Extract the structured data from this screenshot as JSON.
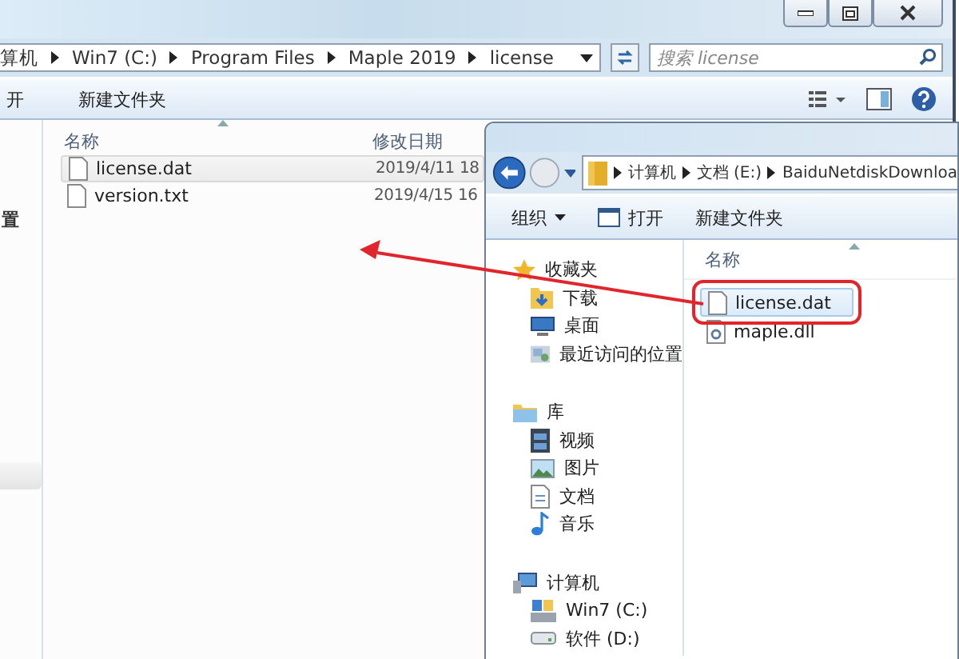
{
  "back_window": {
    "breadcrumb": [
      "算机",
      "Win7 (C:)",
      "Program Files",
      "Maple 2019",
      "license"
    ],
    "search": {
      "placeholder": "搜索 license"
    },
    "toolbar": [
      "开",
      "新建文件夹"
    ],
    "sidebar_fragment": "置",
    "columns": [
      "名称",
      "修改日期"
    ],
    "files": [
      {
        "name": "license.dat",
        "modified": "2019/4/11 18",
        "selected": true
      },
      {
        "name": "version.txt",
        "modified": "2019/4/15 16",
        "selected": false
      }
    ]
  },
  "front_window": {
    "breadcrumb": [
      "计算机",
      "文档 (E:)",
      "BaiduNetdiskDownloa"
    ],
    "toolbar": [
      {
        "label": "组织",
        "kind": "menu"
      },
      {
        "label": "打开",
        "kind": "open"
      },
      {
        "label": "新建文件夹",
        "kind": "plain"
      }
    ],
    "sidebar": [
      {
        "label": "收藏夹",
        "children": [
          {
            "label": "下载"
          },
          {
            "label": "桌面"
          },
          {
            "label": "最近访问的位置"
          }
        ]
      },
      {
        "label": "库",
        "children": [
          {
            "label": "视频"
          },
          {
            "label": "图片"
          },
          {
            "label": "文档"
          },
          {
            "label": "音乐"
          }
        ]
      },
      {
        "label": "计算机",
        "children": [
          {
            "label": "Win7 (C:)"
          },
          {
            "label": "软件 (D:)"
          }
        ]
      }
    ],
    "columns": [
      "名称"
    ],
    "files": [
      {
        "name": "license.dat",
        "selected": true,
        "highlighted": true
      },
      {
        "name": "maple.dll",
        "selected": false,
        "highlighted": false
      }
    ]
  }
}
